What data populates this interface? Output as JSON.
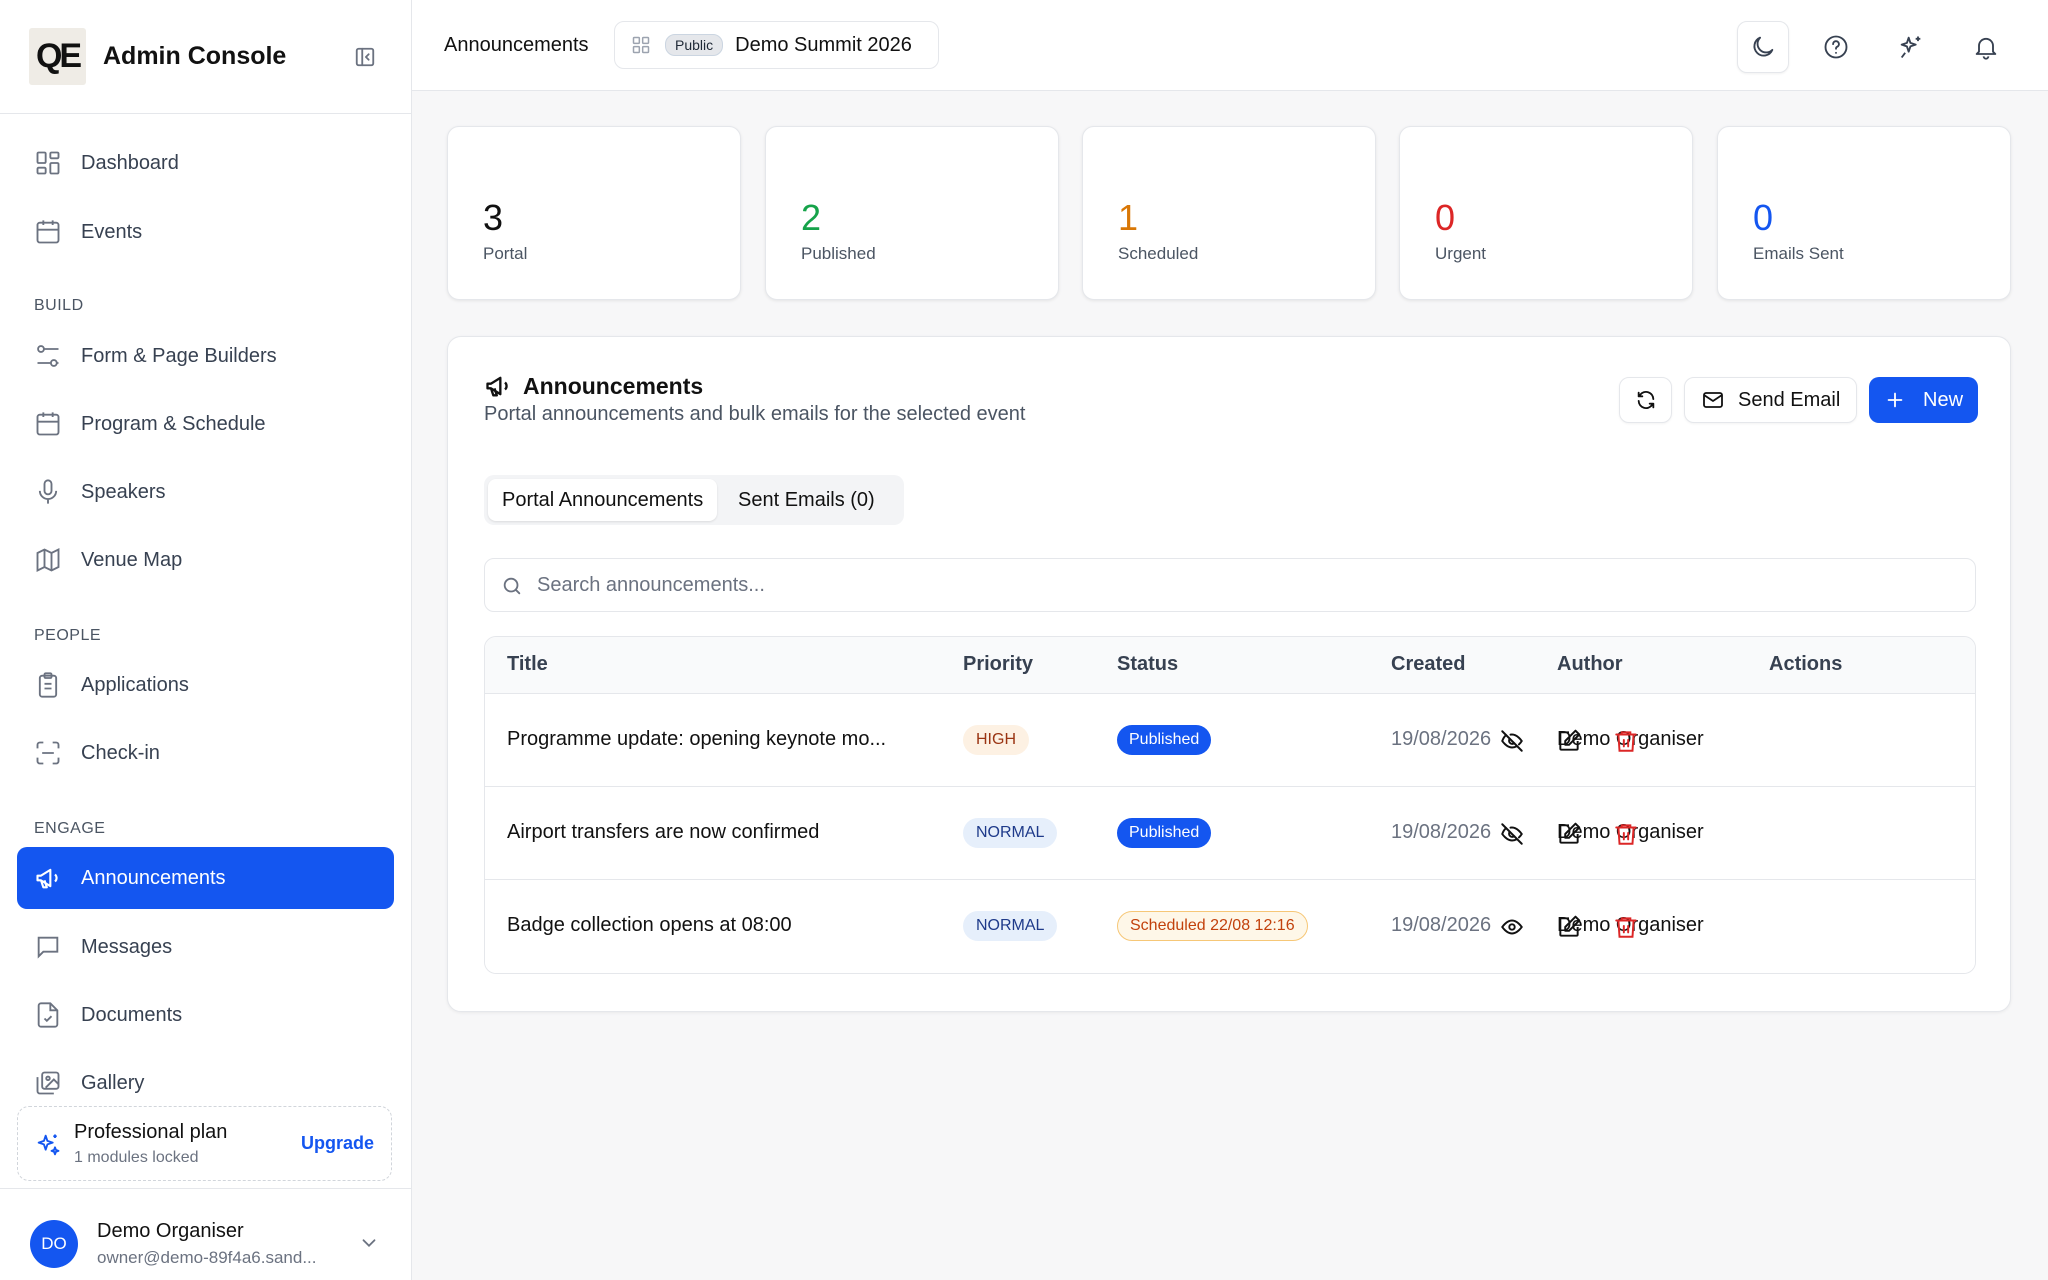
{
  "app": {
    "logo_text": "QE",
    "title": "Admin Console"
  },
  "sidebar": {
    "items": [
      {
        "label": "Dashboard",
        "icon": "grid-icon"
      },
      {
        "label": "Events",
        "icon": "calendar-icon"
      },
      {
        "label": "Form & Page Builders",
        "icon": "sliders-icon"
      },
      {
        "label": "Program & Schedule",
        "icon": "calendar-icon"
      },
      {
        "label": "Speakers",
        "icon": "microphone-icon"
      },
      {
        "label": "Venue Map",
        "icon": "map-icon"
      },
      {
        "label": "Applications",
        "icon": "clipboard-icon"
      },
      {
        "label": "Check-in",
        "icon": "scan-icon"
      },
      {
        "label": "Announcements",
        "icon": "megaphone-icon",
        "active": true
      },
      {
        "label": "Messages",
        "icon": "message-icon"
      },
      {
        "label": "Documents",
        "icon": "document-icon"
      },
      {
        "label": "Gallery",
        "icon": "images-icon"
      }
    ],
    "sections": {
      "build": "BUILD",
      "people": "PEOPLE",
      "engage": "ENGAGE"
    },
    "plan": {
      "name": "Professional plan",
      "detail": "1 modules locked",
      "upgrade_label": "Upgrade"
    },
    "user": {
      "initials": "DO",
      "name": "Demo Organiser",
      "email": "owner@demo-89f4a6.sand..."
    }
  },
  "topbar": {
    "breadcrumb": "Announcements",
    "event_badge": "Public",
    "event_name": "Demo Summit 2026"
  },
  "stats": [
    {
      "value": "3",
      "label": "Portal",
      "color": "#111111"
    },
    {
      "value": "2",
      "label": "Published",
      "color": "#16a34a"
    },
    {
      "value": "1",
      "label": "Scheduled",
      "color": "#d97706"
    },
    {
      "value": "0",
      "label": "Urgent",
      "color": "#dc2626"
    },
    {
      "value": "0",
      "label": "Emails Sent",
      "color": "#1456f0"
    }
  ],
  "panel": {
    "title": "Announcements",
    "subtitle": "Portal announcements and bulk emails for the selected event",
    "send_email_label": "Send Email",
    "new_label": "New",
    "tabs": [
      "Portal Announcements",
      "Sent Emails (0)"
    ],
    "search_placeholder": "Search announcements..."
  },
  "table": {
    "columns": [
      "Title",
      "Priority",
      "Status",
      "Created",
      "Author",
      "Actions"
    ],
    "rows": [
      {
        "title": "Programme update: opening keynote mo...",
        "priority": "HIGH",
        "status": "Published",
        "created": "19/08/2026",
        "author": "Demo Organiser"
      },
      {
        "title": "Airport transfers are now confirmed",
        "priority": "NORMAL",
        "status": "Published",
        "created": "19/08/2026",
        "author": "Demo Organiser"
      },
      {
        "title": "Badge collection opens at 08:00",
        "priority": "NORMAL",
        "status": "Scheduled 22/08 12:16",
        "created": "19/08/2026",
        "author": "Demo Organiser"
      }
    ]
  },
  "colors": {
    "accent": "#1456f0",
    "danger": "#dc2626"
  }
}
